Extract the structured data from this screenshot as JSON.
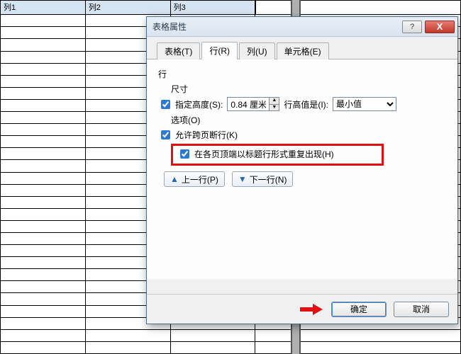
{
  "background": {
    "columns": [
      "列1",
      "列2",
      "列3"
    ]
  },
  "dialog": {
    "title": "表格属性",
    "tabs": {
      "table": "表格(T)",
      "row": "行(R)",
      "column": "列(U)",
      "cell": "单元格(E)"
    },
    "row": {
      "label": "行",
      "size_label": "尺寸",
      "specify_height": "指定高度(S):",
      "height_value": "0.84 厘米",
      "row_height_is": "行高值是(I):",
      "row_height_opt": "最小值",
      "options_label": "选项(O)",
      "allow_break": "允许跨页断行(K)",
      "repeat_header": "在各页顶端以标题行形式重复出现(H)",
      "prev": "上一行(P)",
      "next": "下一行(N)"
    },
    "buttons": {
      "ok": "确定",
      "cancel": "取消"
    },
    "help": "?",
    "close": "X"
  }
}
